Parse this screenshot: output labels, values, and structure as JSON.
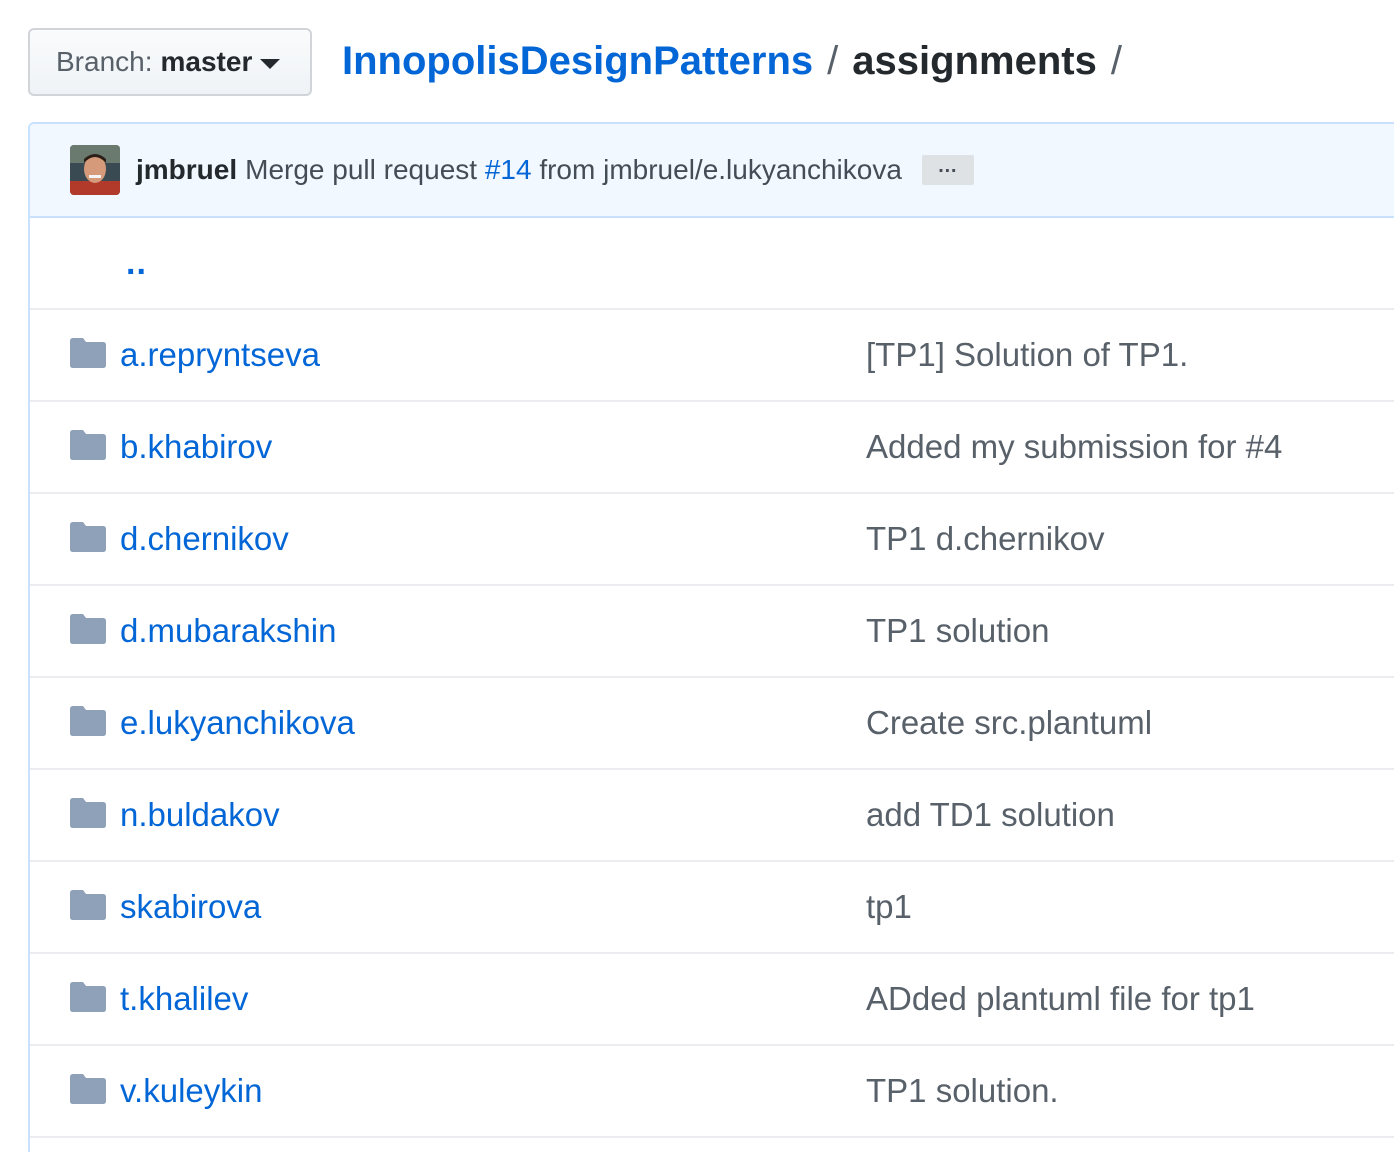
{
  "branch": {
    "label": "Branch:",
    "value": "master"
  },
  "breadcrumb": {
    "repo": "InnopolisDesignPatterns",
    "separator": "/",
    "dir": "assignments",
    "trailing": "/"
  },
  "commit": {
    "author": "jmbruel",
    "message_prefix": "Merge pull request",
    "pr": "#14",
    "message_suffix": "from jmbruel/e.lukyanchikova",
    "ellipsis": "…"
  },
  "parent_dir": "..",
  "files": [
    {
      "name": "a.repryntseva",
      "message": "[TP1] Solution of TP1."
    },
    {
      "name": "b.khabirov",
      "message": "Added my submission for #4"
    },
    {
      "name": "d.chernikov",
      "message": "TP1 d.chernikov"
    },
    {
      "name": "d.mubarakshin",
      "message": "TP1 solution"
    },
    {
      "name": "e.lukyanchikova",
      "message": "Create src.plantuml"
    },
    {
      "name": "n.buldakov",
      "message": "add TD1 solution"
    },
    {
      "name": "skabirova",
      "message": "tp1"
    },
    {
      "name": "t.khalilev",
      "message": "ADded plantuml file for tp1"
    },
    {
      "name": "v.kuleykin",
      "message": "TP1 solution."
    }
  ],
  "colors": {
    "link": "#0366d6",
    "folder": "#8fa1b8",
    "commit_bg": "#f1f8ff",
    "commit_border": "#c8e1ff"
  }
}
